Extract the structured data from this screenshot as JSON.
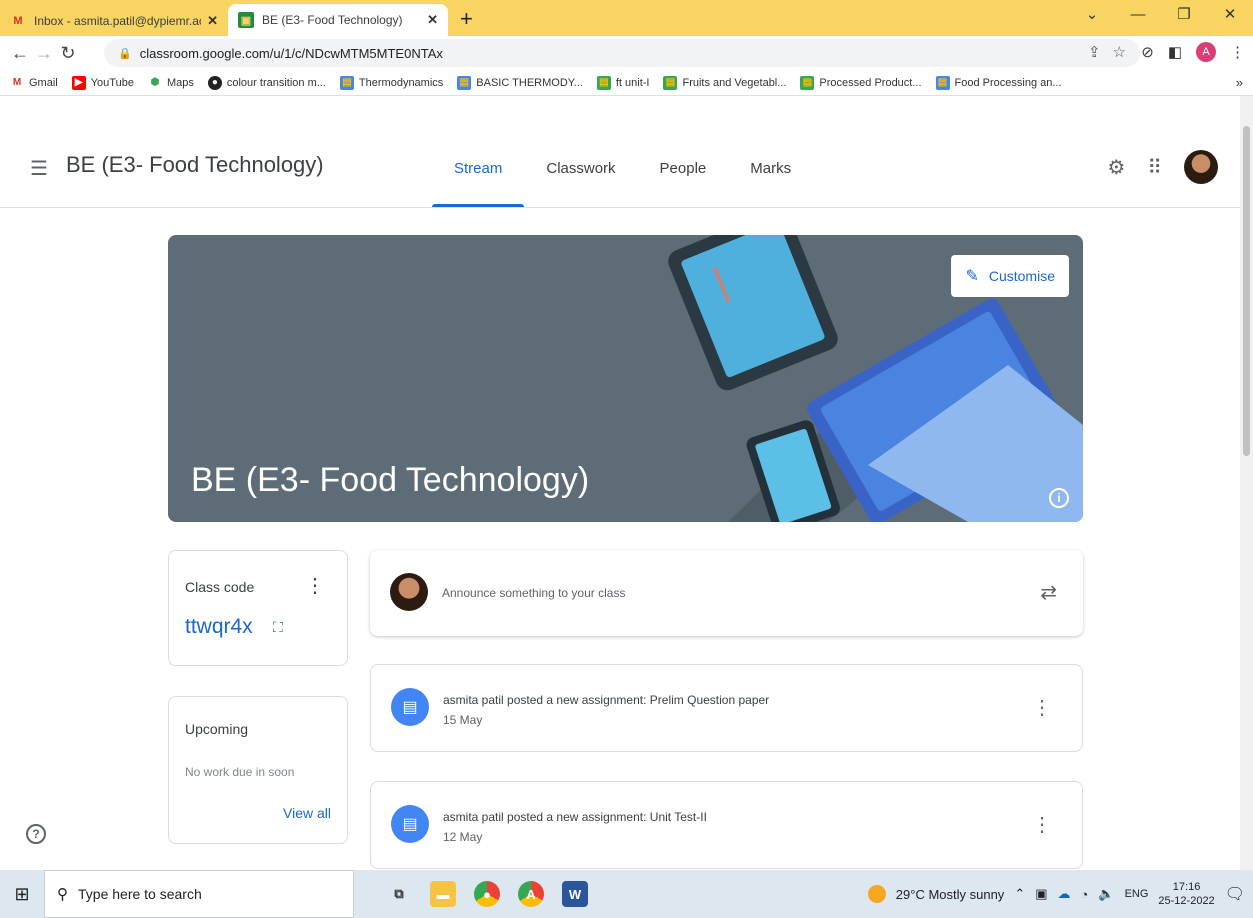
{
  "browser": {
    "tabs": [
      {
        "title": "Inbox - asmita.patil@dypiemr.ac",
        "icon": "gmail-icon",
        "active": false
      },
      {
        "title": "BE (E3- Food Technology)",
        "icon": "classroom-icon",
        "active": true
      }
    ],
    "new_tab": "+",
    "url": "classroom.google.com/u/1/c/NDcwMTM5MTE0NTAx",
    "profile_initial": "A",
    "bookmarks": [
      "Gmail",
      "YouTube",
      "Maps",
      "colour transition m...",
      "Thermodynamics",
      "BASIC THERMODY...",
      "ft unit-I",
      "Fruits and Vegetabl...",
      "Processed Product...",
      "Food Processing an..."
    ],
    "bookmarks_more": "»"
  },
  "classroom": {
    "class_title": "BE (E3- Food Technology)",
    "nav_tabs": [
      "Stream",
      "Classwork",
      "People",
      "Marks"
    ],
    "active_tab": "Stream",
    "banner": {
      "title": "BE (E3- Food Technology)",
      "customise_label": "Customise",
      "color": "#5d6c76"
    },
    "class_code": {
      "label": "Class code",
      "code": "ttwqr4x"
    },
    "upcoming": {
      "label": "Upcoming",
      "empty_text": "No work due in soon",
      "view_all": "View all"
    },
    "announce_placeholder": "Announce something to your class",
    "posts": [
      {
        "title": "asmita patil posted a new assignment: Prelim Question paper",
        "date": "15 May"
      },
      {
        "title": "asmita patil posted a new assignment: Unit Test-II",
        "date": "12 May"
      }
    ],
    "accent_color": "#1967d2"
  },
  "taskbar": {
    "search_placeholder": "Type here to search",
    "weather": "29°C  Mostly sunny",
    "language": "ENG",
    "time": "17:16",
    "date": "25-12-2022"
  }
}
